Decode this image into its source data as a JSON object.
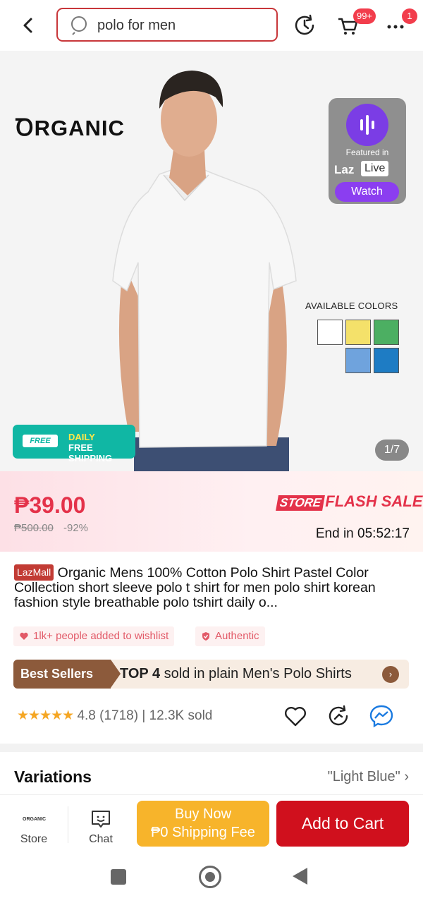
{
  "search": {
    "query": "polo for men"
  },
  "topbar": {
    "cart_badge": "99+",
    "more_badge": "1"
  },
  "hero": {
    "brand": "RGANIC",
    "live": {
      "featured_in": "Featured in",
      "laz": "Laz",
      "live": "Live",
      "watch": "Watch"
    },
    "available_colors_label": "AVAILABLE COLORS",
    "swatch_colors": [
      "#ffffff",
      "#f4e16a",
      "#4caf62",
      "#6fa3dd",
      "#1e7cc4"
    ],
    "shipping": {
      "free_tag": "FREE",
      "line1": "DAILY",
      "line2": "FREE SHIPPING"
    },
    "pager": "1/7"
  },
  "price": {
    "current": "₱39.00",
    "original": "₱500.00",
    "discount": "-92%",
    "flash_store": "STORE",
    "flash_sale": "FLASH SALE",
    "end_in": "End in 05:52:17"
  },
  "product": {
    "badge": "LazMall",
    "title": "Organic Mens 100% Cotton Polo Shirt Pastel Color Collection short sleeve polo t shirt for men polo shirt korean fashion style breathable polo tshirt daily o..."
  },
  "chips": {
    "wishlist": "1lk+ people added to wishlist",
    "authentic": "Authentic"
  },
  "best": {
    "label": "Best Sellers",
    "rank": "TOP 4",
    "text": "sold in plain Men's Polo Shirts"
  },
  "rating": {
    "stars": "★★★★★",
    "score": "4.8",
    "count": "(1718)",
    "sold": "12.3K sold"
  },
  "variations": {
    "label": "Variations",
    "value": "\"Light Blue\" ›"
  },
  "bottom": {
    "store": "Store",
    "store_logo": "ORGANIC",
    "chat": "Chat",
    "buy_now_l1": "Buy Now",
    "buy_now_l2": "₱0 Shipping Fee",
    "add_to_cart": "Add to Cart"
  },
  "colors": {
    "accent": "#d0101d",
    "price": "#e4324a",
    "buy_now": "#f7b42b",
    "best_sellers": "#8c5a3b"
  }
}
